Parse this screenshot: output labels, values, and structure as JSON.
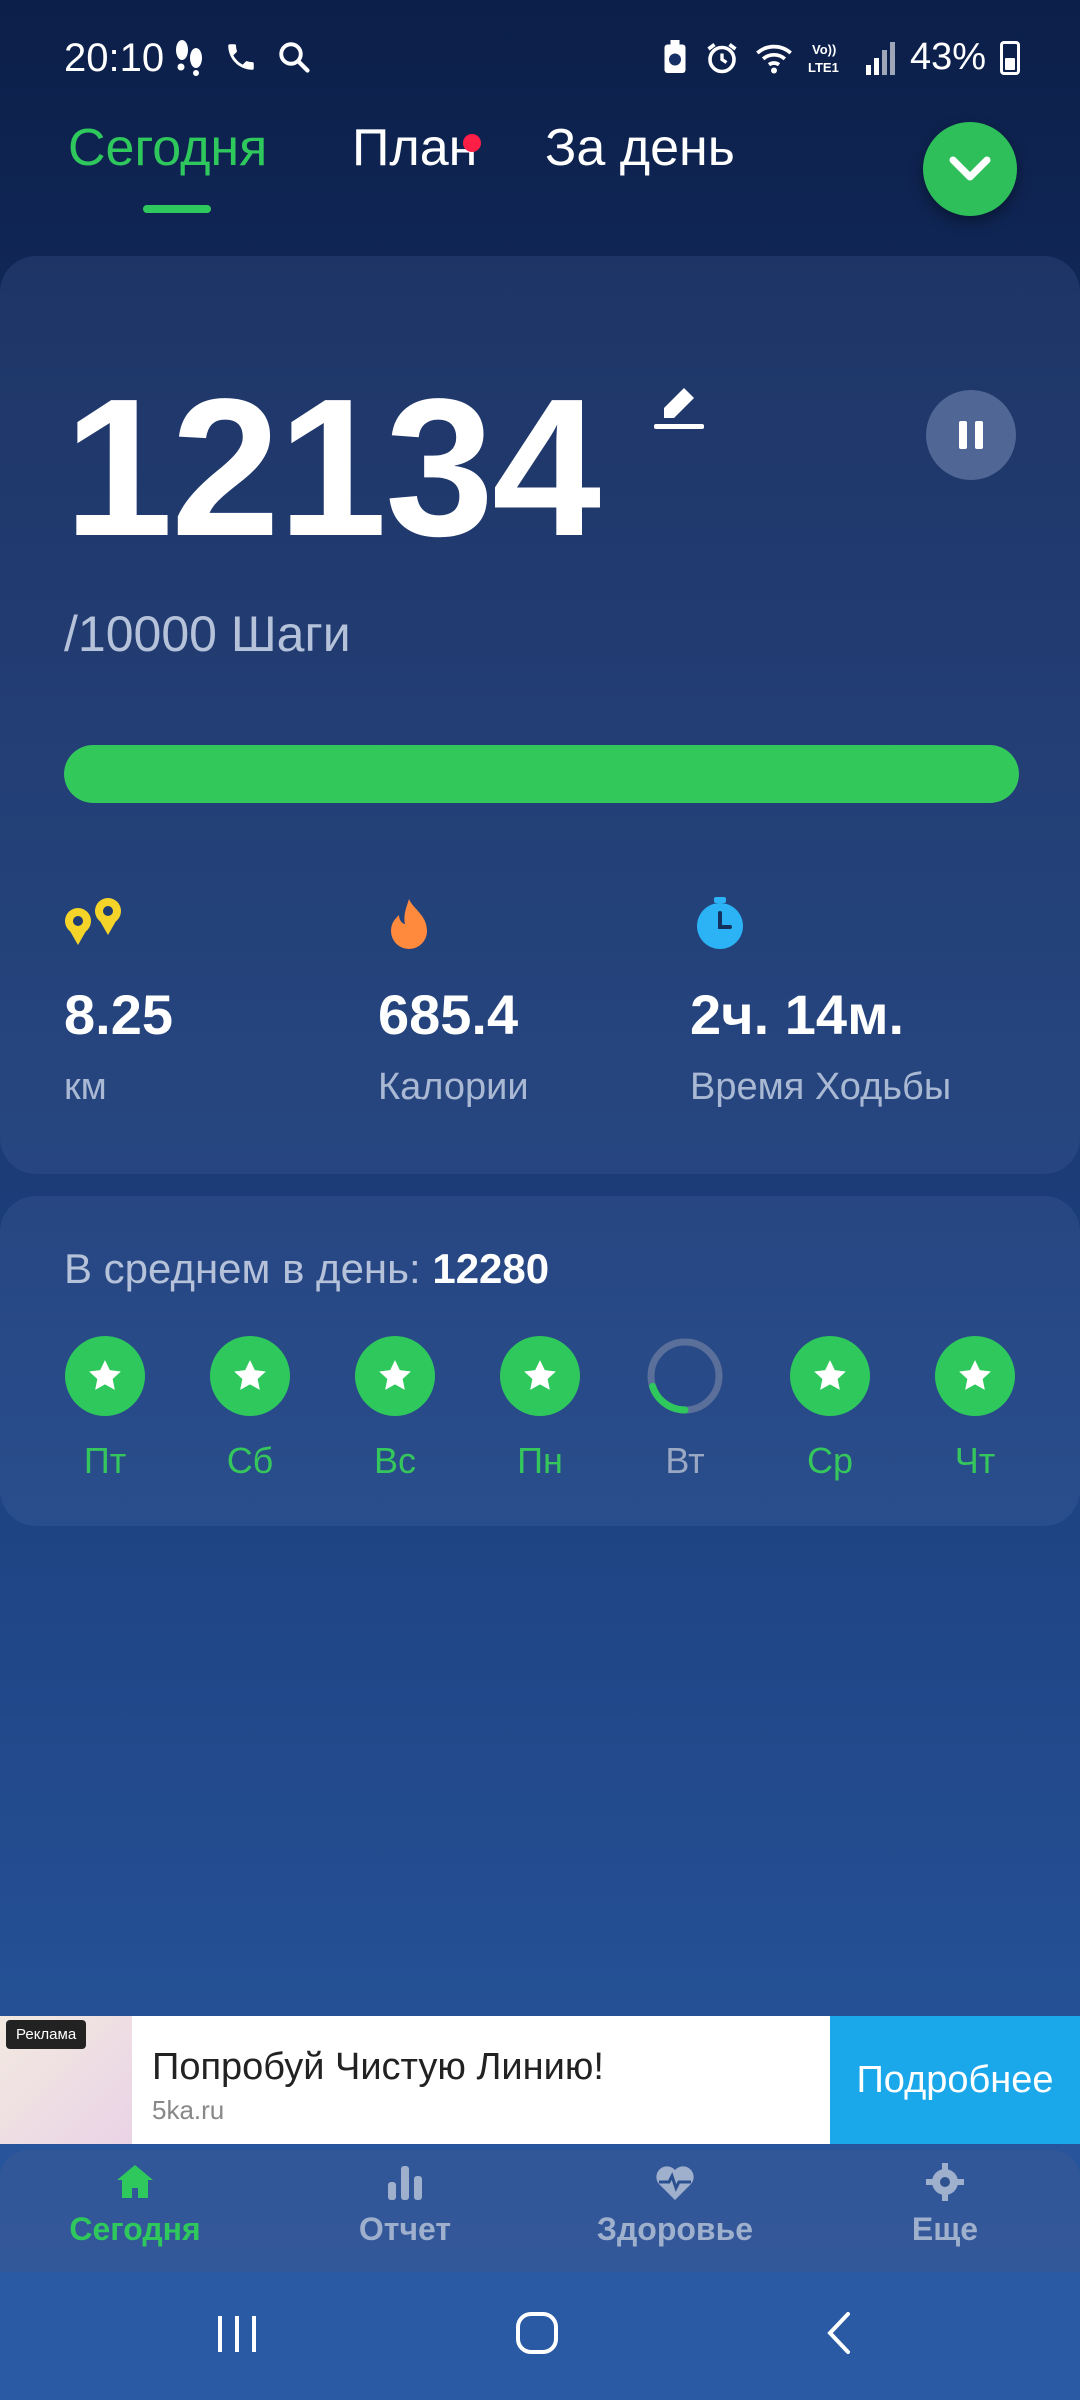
{
  "status": {
    "time": "20:10",
    "battery": "43%"
  },
  "tabs": [
    {
      "label": "Сегодня",
      "active": true
    },
    {
      "label": "План",
      "badge": true
    },
    {
      "label": "За день"
    }
  ],
  "today": {
    "steps": "12134",
    "goal_text": "/10000 Шаги",
    "progress": 1.0,
    "stats": [
      {
        "value": "8.25",
        "label": "км",
        "icon": "distance-icon",
        "color": "#f5d42a"
      },
      {
        "value": "685.4",
        "label": "Калории",
        "icon": "flame-icon",
        "color": "#ff8a3d"
      },
      {
        "value": "2ч. 14м.",
        "label": "Время Ходьбы",
        "icon": "stopwatch-icon",
        "color": "#2cb3f5"
      }
    ]
  },
  "average": {
    "label": "В среднем в день:",
    "value": "12280",
    "days": [
      {
        "label": "Пт",
        "done": true
      },
      {
        "label": "Сб",
        "done": true
      },
      {
        "label": "Вс",
        "done": true
      },
      {
        "label": "Пн",
        "done": true
      },
      {
        "label": "Вт",
        "done": false,
        "progress": 0.2
      },
      {
        "label": "Ср",
        "done": true
      },
      {
        "label": "Чт",
        "done": true
      }
    ]
  },
  "ad": {
    "badge": "Реклама",
    "title": "Попробуй Чистую Линию!",
    "url": "5ka.ru",
    "cta": "Подробнее"
  },
  "bottom_nav": [
    {
      "label": "Сегодня",
      "icon": "home-icon",
      "active": true
    },
    {
      "label": "Отчет",
      "icon": "bar-chart-icon"
    },
    {
      "label": "Здоровье",
      "icon": "heart-pulse-icon"
    },
    {
      "label": "Еще",
      "icon": "gear-icon"
    }
  ]
}
